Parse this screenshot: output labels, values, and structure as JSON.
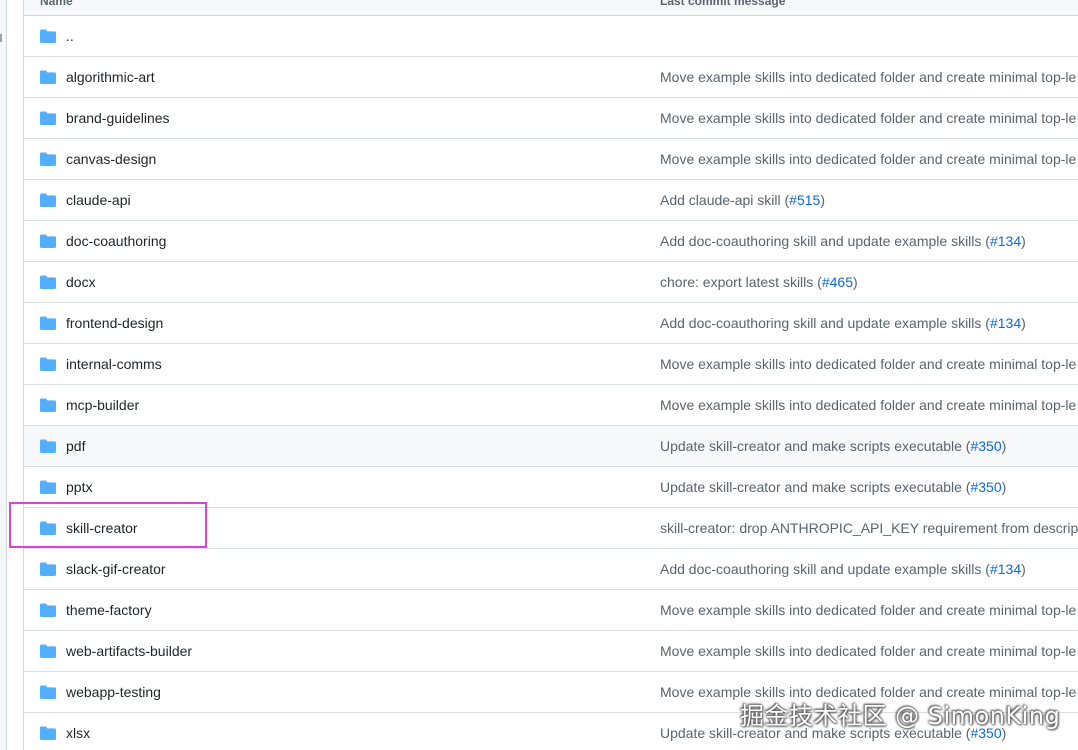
{
  "header": {
    "name_col": "Name",
    "message_col": "Last commit message"
  },
  "rows": [
    {
      "name": "..",
      "message": "",
      "pr": "",
      "suffix": ""
    },
    {
      "name": "algorithmic-art",
      "message": "Move example skills into dedicated folder and create minimal top-le",
      "pr": "",
      "suffix": ""
    },
    {
      "name": "brand-guidelines",
      "message": "Move example skills into dedicated folder and create minimal top-le",
      "pr": "",
      "suffix": ""
    },
    {
      "name": "canvas-design",
      "message": "Move example skills into dedicated folder and create minimal top-le",
      "pr": "",
      "suffix": ""
    },
    {
      "name": "claude-api",
      "message": "Add claude-api skill (",
      "pr": "#515",
      "suffix": ")"
    },
    {
      "name": "doc-coauthoring",
      "message": "Add doc-coauthoring skill and update example skills (",
      "pr": "#134",
      "suffix": ")"
    },
    {
      "name": "docx",
      "message": "chore: export latest skills (",
      "pr": "#465",
      "suffix": ")"
    },
    {
      "name": "frontend-design",
      "message": "Add doc-coauthoring skill and update example skills (",
      "pr": "#134",
      "suffix": ")"
    },
    {
      "name": "internal-comms",
      "message": "Move example skills into dedicated folder and create minimal top-le",
      "pr": "",
      "suffix": ""
    },
    {
      "name": "mcp-builder",
      "message": "Move example skills into dedicated folder and create minimal top-le",
      "pr": "",
      "suffix": ""
    },
    {
      "name": "pdf",
      "message": "Update skill-creator and make scripts executable (",
      "pr": "#350",
      "suffix": ")"
    },
    {
      "name": "pptx",
      "message": "Update skill-creator and make scripts executable (",
      "pr": "#350",
      "suffix": ")"
    },
    {
      "name": "skill-creator",
      "message": "skill-creator: drop ANTHROPIC_API_KEY requirement from descriptio",
      "pr": "",
      "suffix": ""
    },
    {
      "name": "slack-gif-creator",
      "message": "Add doc-coauthoring skill and update example skills (",
      "pr": "#134",
      "suffix": ")"
    },
    {
      "name": "theme-factory",
      "message": "Move example skills into dedicated folder and create minimal top-le",
      "pr": "",
      "suffix": ""
    },
    {
      "name": "web-artifacts-builder",
      "message": "Move example skills into dedicated folder and create minimal top-le",
      "pr": "",
      "suffix": ""
    },
    {
      "name": "webapp-testing",
      "message": "Move example skills into dedicated folder and create minimal top-le",
      "pr": "",
      "suffix": ""
    },
    {
      "name": "xlsx",
      "message": "Update skill-creator and make scripts executable (",
      "pr": "#350",
      "suffix": ")"
    }
  ],
  "hover_row": "pdf",
  "highlighted_row": "skill-creator",
  "watermark": "掘金技术社区 @ SimonKing",
  "colors": {
    "folder": "#54aeff",
    "link": "#0969da",
    "highlight": "#e040e0"
  },
  "icons": {
    "folder": "folder-icon"
  }
}
